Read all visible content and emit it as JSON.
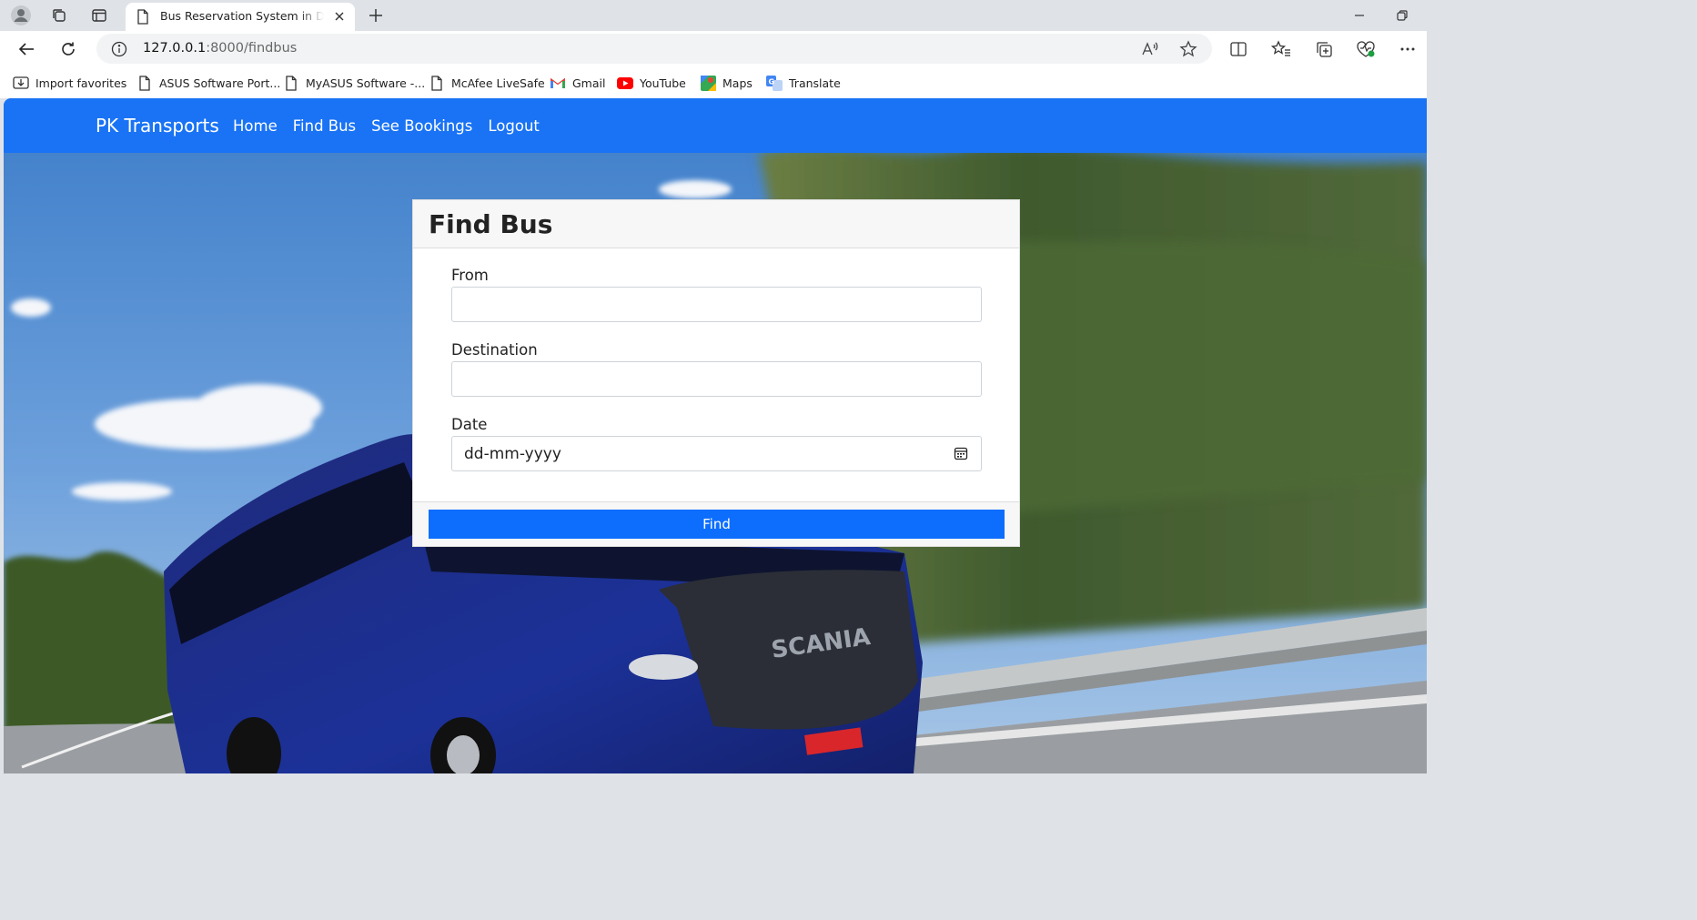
{
  "browser": {
    "tab_title": "Bus Reservation System in Django",
    "url_host": "127.0.0.1",
    "url_path": ":8000/findbus",
    "favorites": [
      {
        "label": "Import favorites",
        "icon": "import-icon"
      },
      {
        "label": "ASUS Software Port...",
        "icon": "page-icon"
      },
      {
        "label": "MyASUS Software -...",
        "icon": "page-icon"
      },
      {
        "label": "McAfee LiveSafe",
        "icon": "page-icon"
      },
      {
        "label": "Gmail",
        "icon": "gmail-icon"
      },
      {
        "label": "YouTube",
        "icon": "youtube-icon"
      },
      {
        "label": "Maps",
        "icon": "maps-icon"
      },
      {
        "label": "Translate",
        "icon": "translate-icon"
      }
    ]
  },
  "navbar": {
    "brand": "PK Transports",
    "links": [
      "Home",
      "Find Bus",
      "See Bookings",
      "Logout"
    ],
    "color": "#1a73f5"
  },
  "form": {
    "title": "Find Bus",
    "from_label": "From",
    "destination_label": "Destination",
    "date_label": "Date",
    "date_placeholder": "dd-mm-yyyy",
    "submit_label": "Find",
    "button_color": "#0d6efd"
  }
}
